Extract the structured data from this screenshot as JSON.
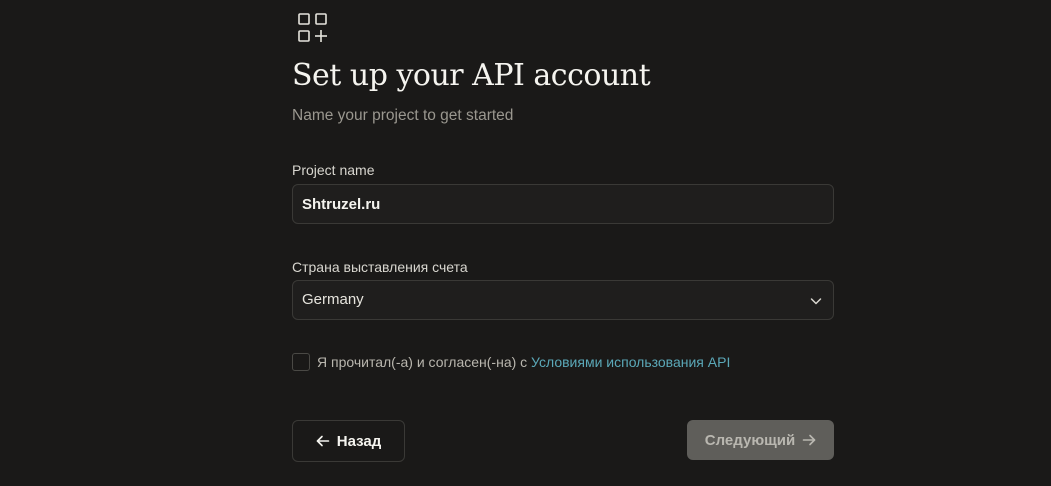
{
  "header": {
    "logo_icon": "grid-plus-icon",
    "title": "Set up your API account",
    "subtitle": "Name your project to get started"
  },
  "form": {
    "project_name": {
      "label": "Project name",
      "value": "Shtruzel.ru"
    },
    "billing_country": {
      "label": "Страна выставления счета",
      "selected": "Germany",
      "icon": "chevron-down-icon"
    },
    "terms": {
      "checked": false,
      "text": "Я прочитал(-а) и согласен(-на) с ",
      "link_text": "Условиями использования API"
    }
  },
  "actions": {
    "back_label": "Назад",
    "back_icon": "arrow-left-icon",
    "next_label": "Следующий",
    "next_icon": "arrow-right-icon"
  },
  "colors": {
    "background": "#1a1918",
    "link": "#5ba8b8",
    "next_button_disabled": "#5f5e5a"
  }
}
